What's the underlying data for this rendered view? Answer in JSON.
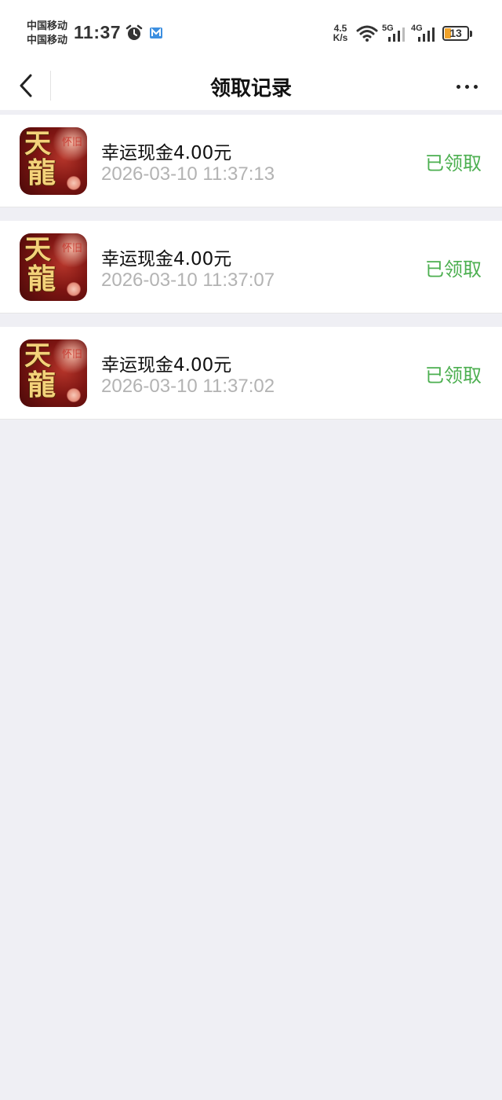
{
  "status_bar": {
    "carrier_1": "中国移动",
    "carrier_2": "中国移动",
    "time": "11:37",
    "net_speed_value": "4.5",
    "net_speed_unit": "K/s",
    "sim1_tag": "5G",
    "sim2_tag": "4G",
    "battery_level": "13",
    "icons": [
      "alarm-icon",
      "app-notification-icon",
      "wifi-icon",
      "signal-icon",
      "battery-icon"
    ]
  },
  "header": {
    "title": "领取记录",
    "back_icon": "chevron-left-icon",
    "more_icon": "more-dots-icon"
  },
  "records": [
    {
      "title": "幸运现金4.00元",
      "time": "2026-03-10 11:37:13",
      "status": "已领取"
    },
    {
      "title": "幸运现金4.00元",
      "time": "2026-03-10 11:37:07",
      "status": "已领取"
    },
    {
      "title": "幸运现金4.00元",
      "time": "2026-03-10 11:37:02",
      "status": "已领取"
    }
  ],
  "app_icon_glyphs": {
    "top": "天",
    "bottom": "龍",
    "seal": "怀旧"
  },
  "colors": {
    "status_claimed": "#4caf50",
    "timestamp": "#b3b3b3",
    "background": "#efeff4",
    "battery_low": "#f0a22a"
  }
}
